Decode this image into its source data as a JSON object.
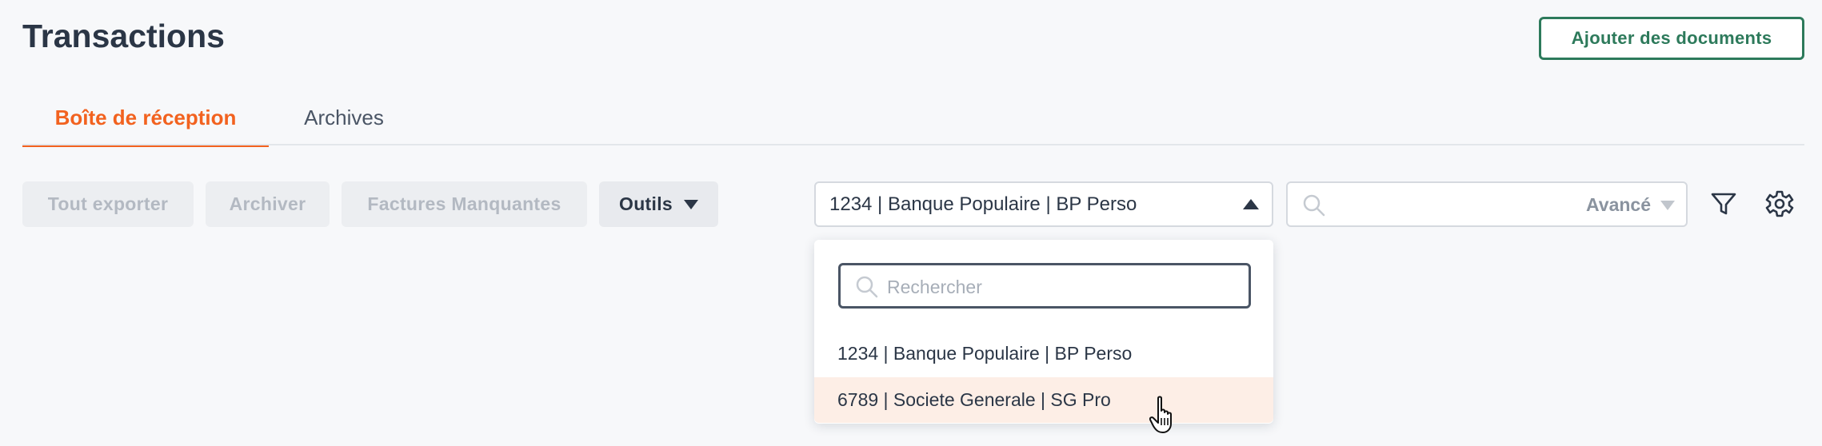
{
  "header": {
    "title": "Transactions",
    "add_documents_label": "Ajouter des documents"
  },
  "tabs": [
    {
      "label": "Boîte de réception",
      "active": true
    },
    {
      "label": "Archives",
      "active": false
    }
  ],
  "toolbar": {
    "export_all_label": "Tout exporter",
    "archive_label": "Archiver",
    "missing_invoices_label": "Factures Manquantes",
    "tools_label": "Outils"
  },
  "account_select": {
    "selected": "1234 | Banque Populaire | BP Perso",
    "search_placeholder": "Rechercher",
    "options": [
      "1234 | Banque Populaire | BP Perso",
      "6789 | Societe Generale | SG Pro"
    ],
    "hovered_index": 1
  },
  "search": {
    "value": "",
    "advanced_label": "Avancé"
  },
  "icons": {
    "filter": "filter-icon",
    "settings": "gear-icon",
    "search": "search-icon"
  },
  "colors": {
    "accent": "#f2621f",
    "primary_green": "#2d7a5b",
    "hover_bg": "#fdeee6",
    "text": "#2b3646"
  }
}
